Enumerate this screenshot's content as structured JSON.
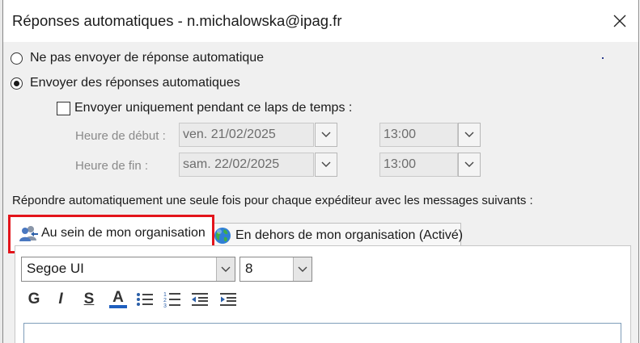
{
  "window": {
    "title": "Réponses automatiques - n.michalowska@ipag.fr"
  },
  "options": {
    "no_reply_label": "Ne pas envoyer de réponse automatique",
    "send_replies_label": "Envoyer des réponses automatiques",
    "send_replies_selected": true,
    "time_range_label": "Envoyer uniquement pendant ce laps de temps :",
    "time_range_checked": false
  },
  "schedule": {
    "start_label": "Heure de début :",
    "start_date": "ven. 21/02/2025",
    "start_time": "13:00",
    "end_label": "Heure de fin :",
    "end_date": "sam. 22/02/2025",
    "end_time": "13:00"
  },
  "instruction": "Répondre automatiquement une seule fois pour chaque expéditeur avec les messages suivants :",
  "tabs": {
    "inside_label": "Au sein de mon organisation",
    "outside_label": "En dehors de mon organisation (Activé)",
    "active": "inside"
  },
  "editor": {
    "font_name": "Segoe UI",
    "font_size": "8",
    "bold_label": "G",
    "italic_label": "I",
    "underline_label": "S",
    "font_color_label": "A"
  },
  "colors": {
    "highlight": "#e3141b",
    "font_color_bar": "#1f5fbf"
  }
}
